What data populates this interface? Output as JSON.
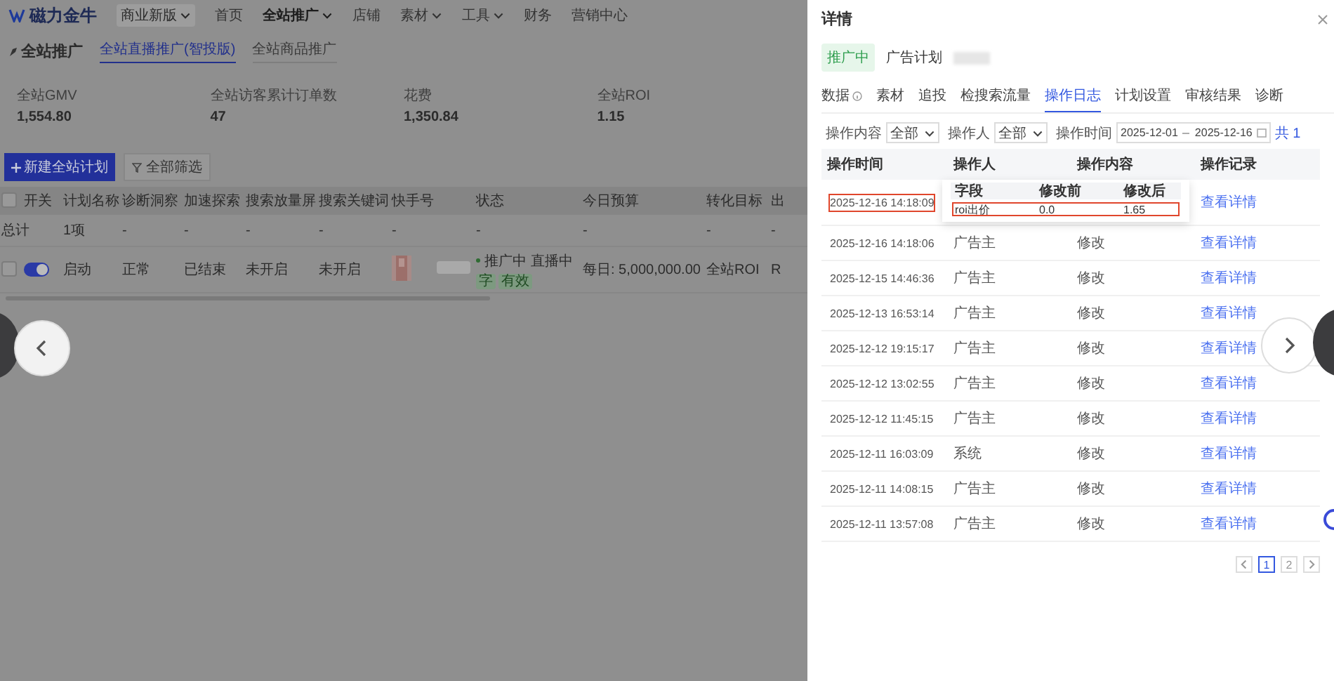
{
  "app_bar": {
    "logo": "磁力金牛",
    "account": "商业新版",
    "nav": [
      {
        "label": "首页",
        "selected": false,
        "dropdown": false
      },
      {
        "label": "全站推广",
        "selected": true,
        "dropdown": true
      },
      {
        "label": "店铺",
        "selected": false,
        "dropdown": false
      },
      {
        "label": "素材",
        "selected": false,
        "dropdown": true
      },
      {
        "label": "工具",
        "selected": false,
        "dropdown": true
      },
      {
        "label": "财务",
        "selected": false,
        "dropdown": false
      },
      {
        "label": "营销中心",
        "selected": false,
        "dropdown": false
      }
    ]
  },
  "page": {
    "title": "全站推广",
    "tabs": [
      {
        "label": "全站直播推广(智投版)",
        "selected": true
      },
      {
        "label": "全站商品推广",
        "selected": false
      }
    ]
  },
  "stats": [
    {
      "label": "全站GMV",
      "value": "1,554.80"
    },
    {
      "label": "全站访客累计订单数",
      "value": "47"
    },
    {
      "label": "花费",
      "value": "1,350.84"
    },
    {
      "label": "全站ROI",
      "value": "1.15"
    }
  ],
  "toolbar": {
    "create_button": "新建全站计划",
    "filter_button": "全部筛选"
  },
  "plan_table": {
    "select_all_checked": false,
    "columns": [
      "开关",
      "计划名称",
      "诊断洞察",
      "加速探索",
      "搜索放量屏",
      "搜索关键词",
      "快手号",
      "状态",
      "今日预算",
      "转化目标",
      "出"
    ],
    "total_row": {
      "label": "总计",
      "count": "1项",
      "cells": [
        "-",
        "-",
        "-",
        "-",
        "-",
        "-",
        "-",
        "-",
        "-"
      ]
    },
    "rows": [
      {
        "checked": false,
        "on": true,
        "name": "启动",
        "diagnosis": "正常",
        "explore": "已结束",
        "search_boost": "未开启",
        "search_keywords": "未开启",
        "status": "推广中",
        "live_status": "直播中",
        "tags": [
          "字",
          "有效"
        ],
        "budget": "每日: 5,000,000.00",
        "goal": "全站ROI",
        "column_12": "R"
      }
    ]
  },
  "drawer": {
    "title": "详情",
    "status_tag": "推广中",
    "plan_label": "广告计划",
    "tabs": [
      {
        "label": "数据",
        "selected": false,
        "info": true
      },
      {
        "label": "素材",
        "selected": false,
        "info": false
      },
      {
        "label": "追投",
        "selected": false,
        "info": false
      },
      {
        "label": "检搜索流量",
        "selected": false,
        "info": false
      },
      {
        "label": "操作日志",
        "selected": true,
        "info": false
      },
      {
        "label": "计划设置",
        "selected": false,
        "info": false
      },
      {
        "label": "审核结果",
        "selected": false,
        "info": false
      },
      {
        "label": "诊断",
        "selected": false,
        "info": false
      }
    ],
    "filters": {
      "content_label": "操作内容",
      "content_value": "全部",
      "operator_label": "操作人",
      "operator_value": "全部",
      "time_label": "操作时间",
      "start_date": "2025-12-01",
      "end_date": "2025-12-16",
      "total": "共 1"
    },
    "log_table": {
      "columns": [
        "操作时间",
        "操作人",
        "操作内容",
        "操作记录"
      ],
      "rows": [
        {
          "time": "2025-12-16 14:18:09",
          "highlighted": true,
          "link": "查看详情"
        },
        {
          "time": "2025-12-16 14:18:06",
          "highlighted": false,
          "operator": "广告主",
          "content": "修改",
          "link": "查看详情"
        },
        {
          "time": "2025-12-15 14:46:36",
          "highlighted": false,
          "operator": "广告主",
          "content": "修改",
          "link": "查看详情"
        },
        {
          "time": "2025-12-13 16:53:14",
          "highlighted": false,
          "operator": "广告主",
          "content": "修改",
          "link": "查看详情"
        },
        {
          "time": "2025-12-12 19:15:17",
          "highlighted": false,
          "operator": "广告主",
          "content": "修改",
          "link": "查看详情"
        },
        {
          "time": "2025-12-12 13:02:55",
          "highlighted": false,
          "operator": "广告主",
          "content": "修改",
          "link": "查看详情"
        },
        {
          "time": "2025-12-12 11:45:15",
          "highlighted": false,
          "operator": "广告主",
          "content": "修改",
          "link": "查看详情"
        },
        {
          "time": "2025-12-11 16:03:09",
          "highlighted": false,
          "operator": "系统",
          "content": "修改",
          "link": "查看详情"
        },
        {
          "time": "2025-12-11 14:08:15",
          "highlighted": false,
          "operator": "广告主",
          "content": "修改",
          "link": "查看详情"
        },
        {
          "time": "2025-12-11 13:57:08",
          "highlighted": false,
          "operator": "广告主",
          "content": "修改",
          "link": "查看详情"
        }
      ]
    },
    "change_popover": {
      "columns": [
        "字段",
        "修改前",
        "修改后"
      ],
      "rows": [
        {
          "field": "roi出价",
          "before": "0.0",
          "after": "1.65",
          "highlighted": true
        }
      ]
    },
    "pagination": [
      {
        "label": "1",
        "selected": true
      },
      {
        "label": "2",
        "selected": false
      }
    ]
  }
}
